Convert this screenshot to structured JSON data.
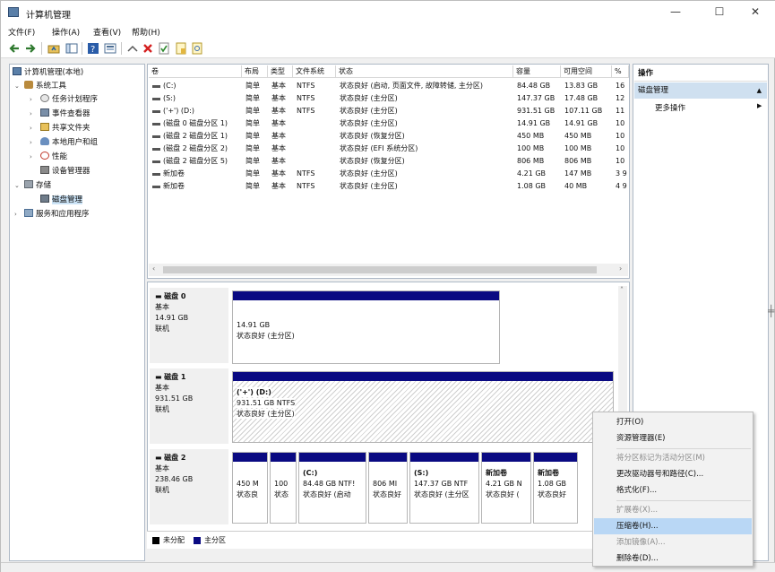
{
  "window": {
    "title": "计算机管理",
    "controls": [
      "—",
      "☐",
      "✕"
    ]
  },
  "menu": [
    "文件(F)",
    "操作(A)",
    "查看(V)",
    "帮助(H)"
  ],
  "tree": [
    {
      "label": "计算机管理(本地)",
      "level": 0,
      "expander": "",
      "icon": "computer-icon"
    },
    {
      "label": "系统工具",
      "level": 1,
      "expander": "⌄",
      "icon": "tools-icon"
    },
    {
      "label": "任务计划程序",
      "level": 2,
      "expander": "›",
      "icon": "clock-icon"
    },
    {
      "label": "事件查看器",
      "level": 2,
      "expander": "›",
      "icon": "event-viewer-icon"
    },
    {
      "label": "共享文件夹",
      "level": 2,
      "expander": "›",
      "icon": "folder-icon"
    },
    {
      "label": "本地用户和组",
      "level": 2,
      "expander": "›",
      "icon": "users-icon"
    },
    {
      "label": "性能",
      "level": 2,
      "expander": "›",
      "icon": "performance-icon"
    },
    {
      "label": "设备管理器",
      "level": 2,
      "expander": "",
      "icon": "device-icon"
    },
    {
      "label": "存储",
      "level": 1,
      "expander": "⌄",
      "icon": "storage-icon"
    },
    {
      "label": "磁盘管理",
      "level": 2,
      "expander": "",
      "icon": "disk-icon",
      "selected": true
    },
    {
      "label": "服务和应用程序",
      "level": 1,
      "expander": "›",
      "icon": "services-icon"
    }
  ],
  "volume_table": {
    "headers": [
      "卷",
      "布局",
      "类型",
      "文件系统",
      "状态",
      "容量",
      "可用空间",
      "%"
    ],
    "rows": [
      [
        "(C:)",
        "简单",
        "基本",
        "NTFS",
        "状态良好 (启动, 页面文件, 故障转储, 主分区)",
        "84.48 GB",
        "13.83 GB",
        "16"
      ],
      [
        "(S:)",
        "简单",
        "基本",
        "NTFS",
        "状态良好 (主分区)",
        "147.37 GB",
        "17.48 GB",
        "12"
      ],
      [
        "('+') (D:)",
        "简单",
        "基本",
        "NTFS",
        "状态良好 (主分区)",
        "931.51 GB",
        "107.11 GB",
        "11"
      ],
      [
        "(磁盘 0 磁盘分区 1)",
        "简单",
        "基本",
        "",
        "状态良好 (主分区)",
        "14.91 GB",
        "14.91 GB",
        "10"
      ],
      [
        "(磁盘 2 磁盘分区 1)",
        "简单",
        "基本",
        "",
        "状态良好 (恢复分区)",
        "450 MB",
        "450 MB",
        "10"
      ],
      [
        "(磁盘 2 磁盘分区 2)",
        "简单",
        "基本",
        "",
        "状态良好 (EFI 系统分区)",
        "100 MB",
        "100 MB",
        "10"
      ],
      [
        "(磁盘 2 磁盘分区 5)",
        "简单",
        "基本",
        "",
        "状态良好 (恢复分区)",
        "806 MB",
        "806 MB",
        "10"
      ],
      [
        "新加卷",
        "简单",
        "基本",
        "NTFS",
        "状态良好 (主分区)",
        "4.21 GB",
        "147 MB",
        "3 9"
      ],
      [
        "新加卷",
        "简单",
        "基本",
        "NTFS",
        "状态良好 (主分区)",
        "1.08 GB",
        "40 MB",
        "4 9"
      ]
    ]
  },
  "disks": [
    {
      "name": "磁盘 0",
      "type": "基本",
      "size": "14.91 GB",
      "status": "联机",
      "partitions": [
        {
          "name": "",
          "line2": "14.91 GB",
          "line3": "状态良好 (主分区)"
        }
      ]
    },
    {
      "name": "磁盘 1",
      "type": "基本",
      "size": "931.51 GB",
      "status": "联机",
      "partitions": [
        {
          "name": "('+')   (D:)",
          "line2": "931.51 GB NTFS",
          "line3": "状态良好 (主分区)"
        }
      ]
    },
    {
      "name": "磁盘 2",
      "type": "基本",
      "size": "238.46 GB",
      "status": "联机",
      "partitions": [
        {
          "name": "",
          "line2": "450 M",
          "line3": "状态良"
        },
        {
          "name": "",
          "line2": "100",
          "line3": "状态"
        },
        {
          "name": "(C:)",
          "line2": "84.48 GB NTF!",
          "line3": "状态良好 (启动"
        },
        {
          "name": "",
          "line2": "806 MI",
          "line3": "状态良好"
        },
        {
          "name": "(S:)",
          "line2": "147.37 GB NTF",
          "line3": "状态良好 (主分区"
        },
        {
          "name": "新加卷",
          "line2": "4.21 GB N",
          "line3": "状态良好 ("
        },
        {
          "name": "新加卷",
          "line2": "1.08 GB",
          "line3": "状态良好"
        }
      ]
    }
  ],
  "legend": [
    {
      "label": "未分配",
      "color": "#000000"
    },
    {
      "label": "主分区",
      "color": "#0a0a82"
    }
  ],
  "actions": {
    "header": "操作",
    "section": "磁盘管理",
    "more": "更多操作"
  },
  "context_menu": [
    {
      "label": "打开(O)",
      "disabled": false
    },
    {
      "label": "资源管理器(E)",
      "disabled": false
    },
    {
      "sep": true
    },
    {
      "label": "将分区标记为活动分区(M)",
      "disabled": true
    },
    {
      "label": "更改驱动器号和路径(C)...",
      "disabled": false
    },
    {
      "label": "格式化(F)...",
      "disabled": false
    },
    {
      "sep": true
    },
    {
      "label": "扩展卷(X)...",
      "disabled": true
    },
    {
      "label": "压缩卷(H)...",
      "disabled": false,
      "highlighted": true
    },
    {
      "label": "添加镜像(A)...",
      "disabled": true
    },
    {
      "label": "删除卷(D)...",
      "disabled": false
    }
  ],
  "colors": {
    "primary_partition": "#0a0a82",
    "selection": "#cce4f7",
    "menu_highlight": "#b9d7f5"
  }
}
